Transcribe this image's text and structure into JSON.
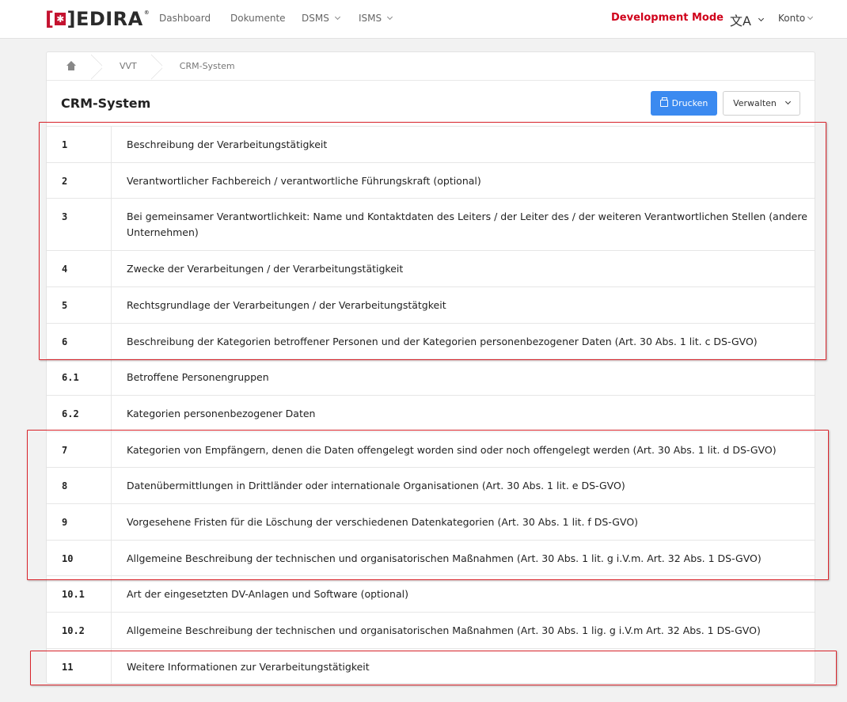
{
  "brand": {
    "name_left": "[",
    "name_star": "✱",
    "name_right": "]EDIRA",
    "registered": "®"
  },
  "nav": {
    "items": [
      {
        "label": "Dashboard",
        "has_dropdown": false
      },
      {
        "label": "Dokumente",
        "has_dropdown": false
      },
      {
        "label": "DSMS",
        "has_dropdown": true
      },
      {
        "label": "ISMS",
        "has_dropdown": true
      }
    ],
    "dev_mode": "Development Mode",
    "language_icon": "translate-icon",
    "account": "Konto"
  },
  "breadcrumb": {
    "home_icon": "home-icon",
    "items": [
      "VVT",
      "CRM-System"
    ]
  },
  "page": {
    "title": "CRM-System",
    "print_label": "Drucken",
    "manage_label": "Verwalten"
  },
  "rows": [
    {
      "num": "1",
      "text": "Beschreibung der Verarbeitungstätigkeit"
    },
    {
      "num": "2",
      "text": "Verantwortlicher Fachbereich / verantwortliche Führungskraft (optional)"
    },
    {
      "num": "3",
      "text": "Bei gemeinsamer Verantwortlichkeit: Name und Kontaktdaten des Leiters / der Leiter des / der weiteren Verantwortlichen Stellen (andere Unternehmen)"
    },
    {
      "num": "4",
      "text": "Zwecke der Verarbeitungen / der Verarbeitungstätigkeit"
    },
    {
      "num": "5",
      "text": "Rechtsgrundlage der Verarbeitungen / der Verarbeitungstätgkeit"
    },
    {
      "num": "6",
      "text": "Beschreibung der Kategorien betroffener Personen und der Kategorien personenbezogener Daten (Art. 30 Abs. 1 lit. c DS-GVO)"
    },
    {
      "num": "6.1",
      "text": "Betroffene Personengruppen"
    },
    {
      "num": "6.2",
      "text": "Kategorien personenbezogener Daten"
    },
    {
      "num": "7",
      "text": "Kategorien von Empfängern, denen die Daten offengelegt worden sind oder noch offengelegt werden (Art. 30 Abs. 1 lit. d DS-GVO)"
    },
    {
      "num": "8",
      "text": "Datenübermittlungen in Drittländer oder internationale Organisationen (Art. 30 Abs. 1 lit. e DS-GVO)"
    },
    {
      "num": "9",
      "text": "Vorgesehene Fristen für die Löschung der verschiedenen Datenkategorien (Art. 30 Abs. 1 lit. f DS-GVO)"
    },
    {
      "num": "10",
      "text": "Allgemeine Beschreibung der technischen und organisatorischen Maßnahmen (Art. 30 Abs. 1 lit. g i.V.m. Art. 32 Abs. 1 DS-GVO)"
    },
    {
      "num": "10.1",
      "text": "Art der eingesetzten DV-Anlagen und Software (optional)"
    },
    {
      "num": "10.2",
      "text": "Allgemeine Beschreibung der technischen und organisatorischen Maßnahmen (Art. 30 Abs. 1 lig. g i.V.m Art. 32 Abs. 1 DS-GVO)"
    },
    {
      "num": "11",
      "text": "Weitere Informationen zur Verarbeitungstätigkeit"
    }
  ],
  "highlight_color": "#d9242b"
}
